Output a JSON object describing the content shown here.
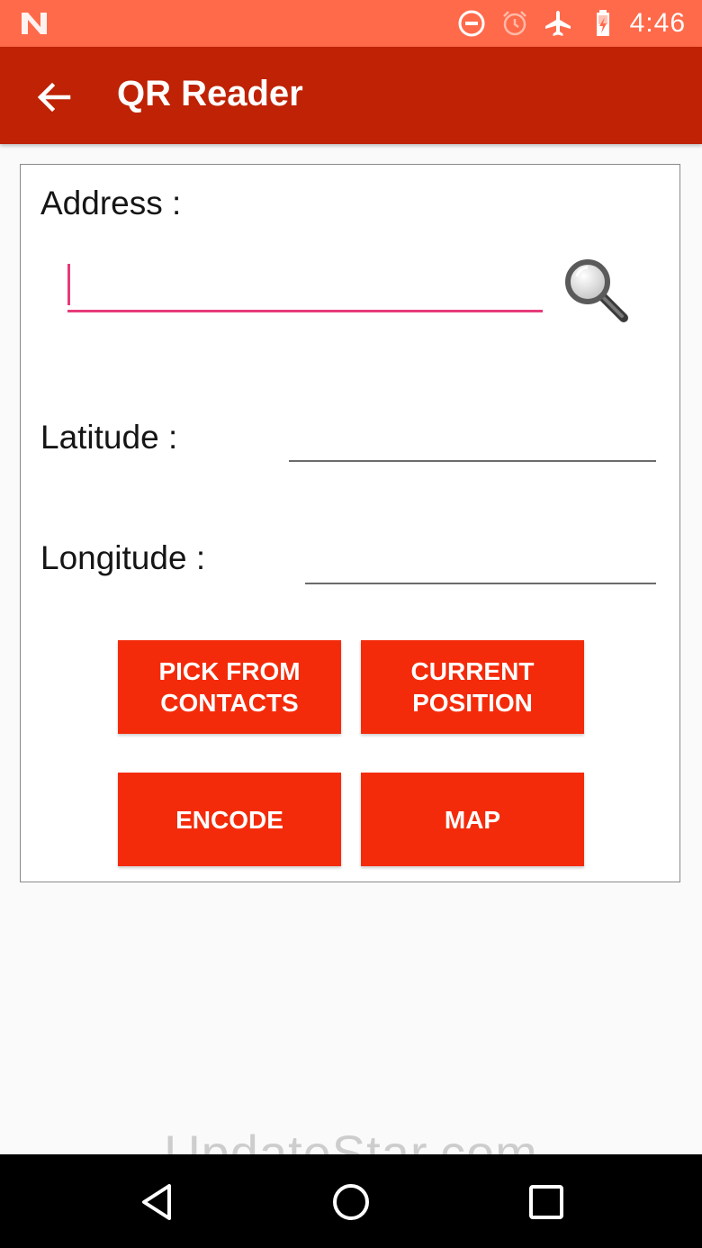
{
  "status_bar": {
    "time": "4:46",
    "icons": [
      "n-logo-icon",
      "do-not-disturb-icon",
      "alarm-icon",
      "airplane-mode-icon",
      "battery-charging-icon"
    ]
  },
  "app_bar": {
    "title": "QR Reader",
    "back_icon": "arrow-back-icon"
  },
  "form": {
    "address_label": "Address :",
    "address_value": "",
    "search_icon": "magnifier-icon",
    "latitude_label": "Latitude :",
    "latitude_value": "",
    "longitude_label": "Longitude :",
    "longitude_value": ""
  },
  "buttons": {
    "pick_from_contacts": "PICK FROM\nCONTACTS",
    "current_position": "CURRENT\nPOSITION",
    "encode": "ENCODE",
    "map": "MAP"
  },
  "watermark": "UpdateStar.com",
  "nav_bar": {
    "icons": [
      "back-triangle-icon",
      "home-circle-icon",
      "recents-square-icon"
    ]
  },
  "colors": {
    "status_bar": "#ff6a4a",
    "app_bar": "#bf2204",
    "button": "#f42b0a",
    "input_accent": "#e63b7a"
  }
}
